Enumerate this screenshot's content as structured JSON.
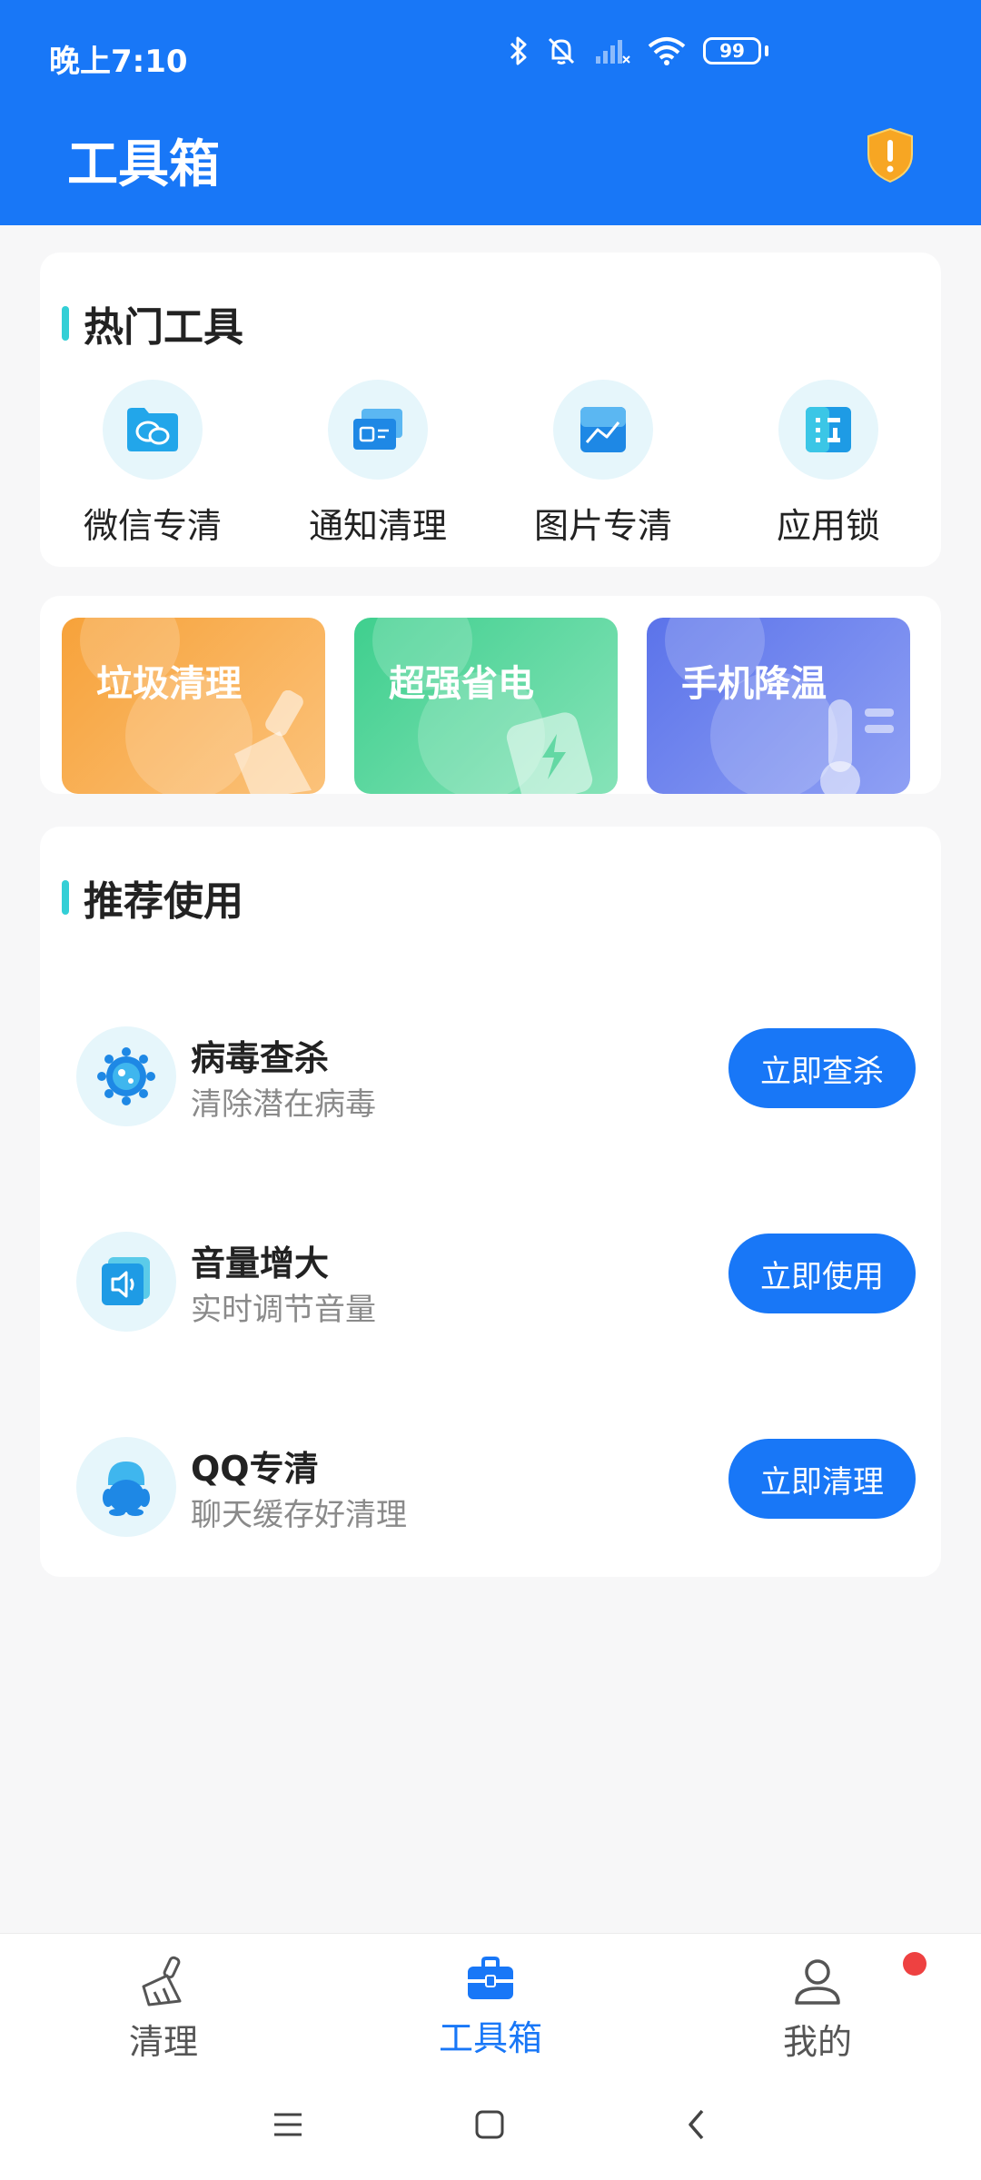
{
  "status_bar": {
    "time": "晚上7:10",
    "battery": "99"
  },
  "header": {
    "title": "工具箱"
  },
  "hot_tools": {
    "title": "热门工具",
    "items": [
      {
        "label": "微信专清",
        "icon": "wechat-folder-icon"
      },
      {
        "label": "通知清理",
        "icon": "notification-card-icon"
      },
      {
        "label": "图片专清",
        "icon": "image-icon"
      },
      {
        "label": "应用锁",
        "icon": "app-lock-icon"
      }
    ]
  },
  "promos": [
    {
      "label": "垃圾清理",
      "icon": "broom-icon",
      "color_from": "#f7a23a",
      "color_to": "#fbc27a"
    },
    {
      "label": "超强省电",
      "icon": "battery-bolt-icon",
      "color_from": "#3fcf8e",
      "color_to": "#86e3b8"
    },
    {
      "label": "手机降温",
      "icon": "thermometer-icon",
      "color_from": "#5b73ea",
      "color_to": "#8fa0f4"
    }
  ],
  "recommended": {
    "title": "推荐使用",
    "items": [
      {
        "title": "病毒查杀",
        "subtitle": "清除潜在病毒",
        "button": "立即查杀",
        "icon": "virus-icon"
      },
      {
        "title": "音量增大",
        "subtitle": "实时调节音量",
        "button": "立即使用",
        "icon": "speaker-icon"
      },
      {
        "title": "QQ专清",
        "subtitle": "聊天缓存好清理",
        "button": "立即清理",
        "icon": "qq-penguin-icon"
      }
    ]
  },
  "bottom_nav": {
    "items": [
      {
        "label": "清理",
        "icon": "broom-icon",
        "active": false
      },
      {
        "label": "工具箱",
        "icon": "toolbox-icon",
        "active": true
      },
      {
        "label": "我的",
        "icon": "user-icon",
        "active": false
      }
    ]
  },
  "colors": {
    "primary": "#1877f7",
    "accent_bar": "#33cfd6",
    "badge": "#ee4141"
  }
}
